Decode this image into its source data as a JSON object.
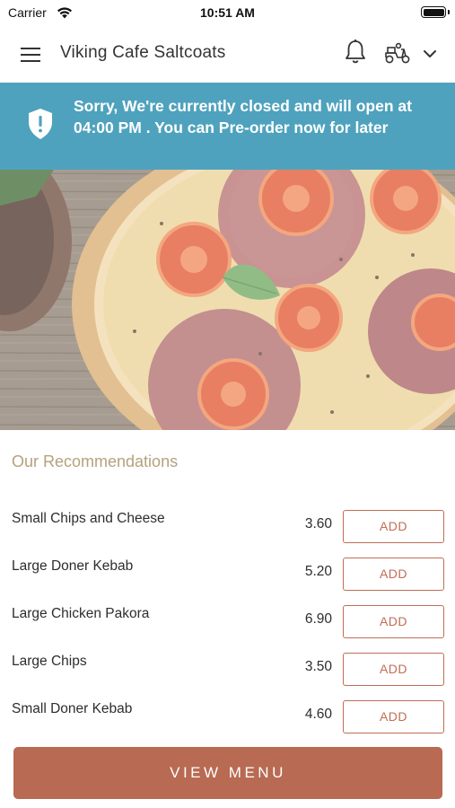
{
  "status_bar": {
    "carrier": "Carrier",
    "time": "10:51 AM",
    "icons": [
      "wifi-icon",
      "battery-icon"
    ]
  },
  "header": {
    "title": "Viking Cafe Saltcoats",
    "icons": [
      "hamburger-menu-icon",
      "bell-icon",
      "scooter-icon",
      "chevron-down-icon"
    ]
  },
  "banner": {
    "message": "Sorry, We're currently closed and will open at 04:00 PM . You can Pre-order now for later",
    "background_color": "#4fa2bd",
    "icon": "shield-alert-icon"
  },
  "hero": {
    "icon": "pizza-photo"
  },
  "recommendations": {
    "title": "Our Recommendations",
    "items": [
      {
        "name": "Small Chips and Cheese",
        "price": "3.60",
        "button": "ADD"
      },
      {
        "name": "Large Doner Kebab",
        "price": "5.20",
        "button": "ADD"
      },
      {
        "name": "Large Chicken Pakora",
        "price": "6.90",
        "button": "ADD"
      },
      {
        "name": "Large Chips",
        "price": "3.50",
        "button": "ADD"
      },
      {
        "name": "Small Doner Kebab",
        "price": "4.60",
        "button": "ADD"
      }
    ]
  },
  "footer": {
    "view_menu_label": "VIEW MENU",
    "accent_color": "#b86a52"
  }
}
